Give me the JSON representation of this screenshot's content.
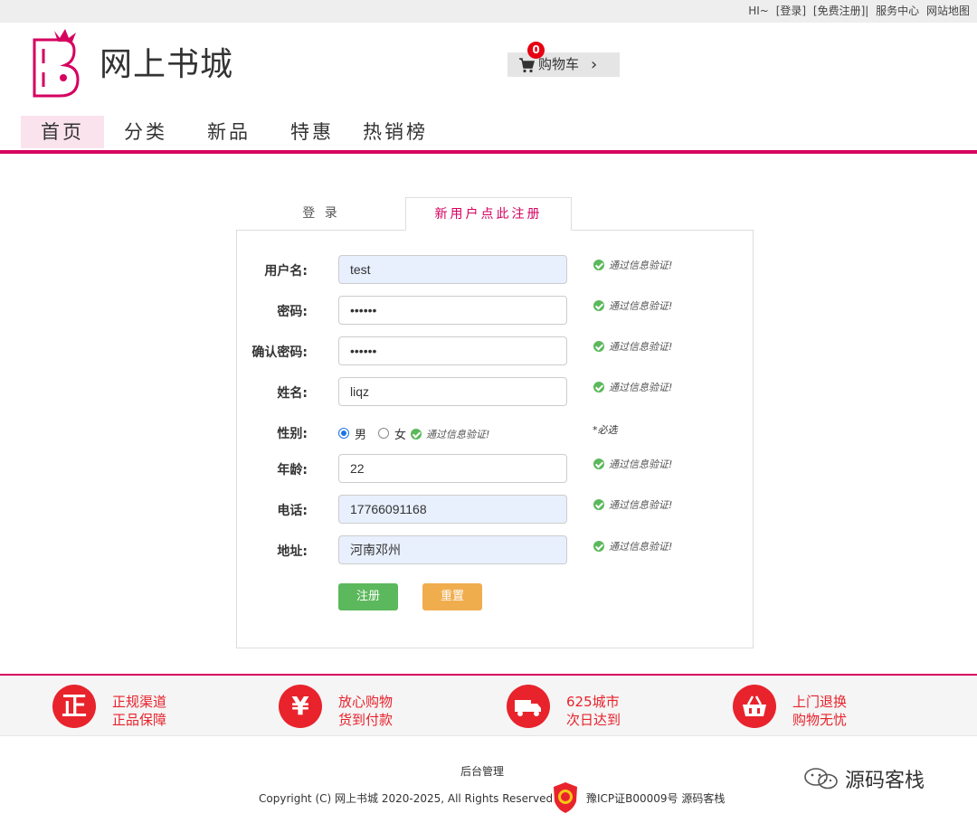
{
  "topbar": {
    "greeting": "HI~",
    "login": "[登录]",
    "register": "[免费注册]|",
    "service": "服务中心",
    "sitemap": "网站地图"
  },
  "header": {
    "site_title": "网上书城",
    "cart_label": "购物车",
    "cart_count": "0",
    "cart_chevron": "›"
  },
  "nav": {
    "items": [
      {
        "label": "首页",
        "active": true
      },
      {
        "label": "分类"
      },
      {
        "label": "新品"
      },
      {
        "label": "特惠"
      },
      {
        "label": "热销榜"
      }
    ]
  },
  "tabs": {
    "login": "登 录",
    "register": "新用户点此注册"
  },
  "form": {
    "username_label": "用户名:",
    "username_value": "test",
    "password_label": "密码:",
    "password_value": "••••••",
    "confirm_label": "确认密码:",
    "confirm_value": "••••••",
    "name_label": "姓名:",
    "name_value": "liqz",
    "gender_label": "性别:",
    "gender_male": "男",
    "gender_female": "女",
    "gender_selected": "男",
    "age_label": "年龄:",
    "age_value": "22",
    "phone_label": "电话:",
    "phone_value": "17766091168",
    "address_label": "地址:",
    "address_value": "河南邓州",
    "valid_text": "通过信息验证!",
    "required_note": "*必选",
    "submit_label": "注册",
    "reset_label": "重置"
  },
  "features": [
    {
      "icon": "正",
      "line1": "正规渠道",
      "line2": "正品保障"
    },
    {
      "icon": "¥",
      "line1": "放心购物",
      "line2": "货到付款"
    },
    {
      "icon": "truck-icon",
      "line1": "625城市",
      "line2": "次日达到"
    },
    {
      "icon": "basket-icon",
      "line1": "上门退换",
      "line2": "购物无忧"
    }
  ],
  "footer": {
    "admin_link": "后台管理",
    "copyright": "Copyright (C) 网上书城 2020-2025, All Rights Reserved",
    "icp": "豫ICP证B00009号 源码客栈",
    "watermark": "源码客栈"
  },
  "colors": {
    "brand": "#d6005f",
    "feature_red": "#e8232c",
    "valid_green": "#5cb85c",
    "submit_green": "#5cb85c",
    "reset_orange": "#f0ad4e"
  }
}
